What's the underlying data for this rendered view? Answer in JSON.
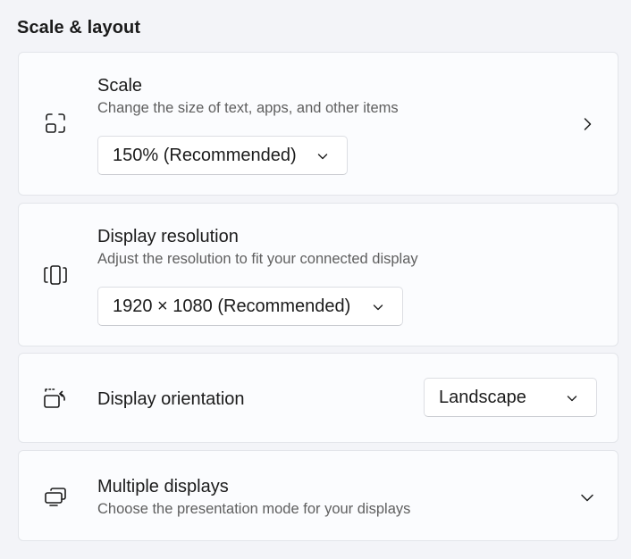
{
  "section": {
    "title": "Scale & layout"
  },
  "scale": {
    "title": "Scale",
    "description": "Change the size of text, apps, and other items",
    "selected": "150% (Recommended)",
    "icon": "scale-icon"
  },
  "resolution": {
    "title": "Display resolution",
    "description": "Adjust the resolution to fit your connected display",
    "selected": "1920 × 1080 (Recommended)",
    "icon": "display-resolution-icon"
  },
  "orientation": {
    "title": "Display orientation",
    "selected": "Landscape",
    "icon": "display-orientation-icon"
  },
  "multiple": {
    "title": "Multiple displays",
    "description": "Choose the presentation mode for your displays",
    "icon": "multiple-displays-icon"
  }
}
